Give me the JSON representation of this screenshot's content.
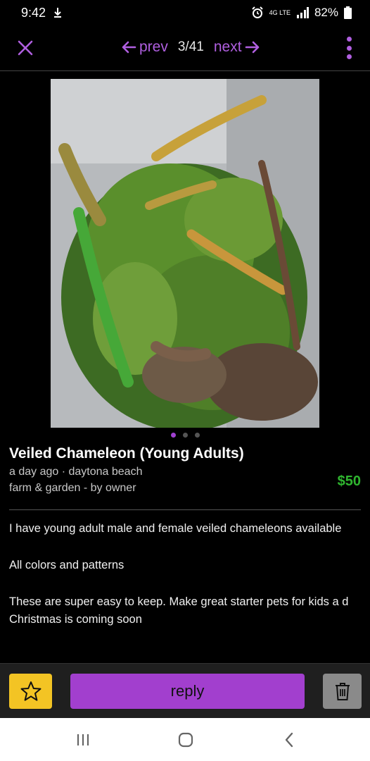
{
  "status_bar": {
    "time": "9:42",
    "network_label": "4G LTE",
    "battery_percent": "82%",
    "icons": [
      "download-icon",
      "alarm-icon",
      "network-icon",
      "signal-icon",
      "battery-icon"
    ]
  },
  "nav": {
    "close_icon": "close-icon",
    "prev_label": "prev",
    "position": "3/41",
    "next_label": "next",
    "menu_icon": "more-vertical-icon"
  },
  "gallery": {
    "image_description": "chameleons",
    "total_dots": 3,
    "active_dot": 0
  },
  "listing": {
    "title": "Veiled Chameleon (Young Adults)",
    "posted": "a day ago · daytona beach",
    "category": "farm & garden - by owner",
    "price": "$50",
    "body": [
      "I have young adult male and female veiled chameleons available",
      "All colors and patterns",
      "These are super easy to keep. Make great starter pets for kids a d Christmas is coming soon"
    ]
  },
  "actions": {
    "favorite_icon": "star-icon",
    "reply_label": "reply",
    "delete_icon": "trash-icon"
  },
  "android_nav": {
    "icons": [
      "recents-icon",
      "home-icon",
      "back-icon"
    ]
  },
  "colors": {
    "accent": "#a23fce",
    "link": "#b05fe0",
    "price": "#2fb52f",
    "star_button": "#f3c424",
    "trash_button": "#8a8a8a",
    "background": "#000000"
  }
}
